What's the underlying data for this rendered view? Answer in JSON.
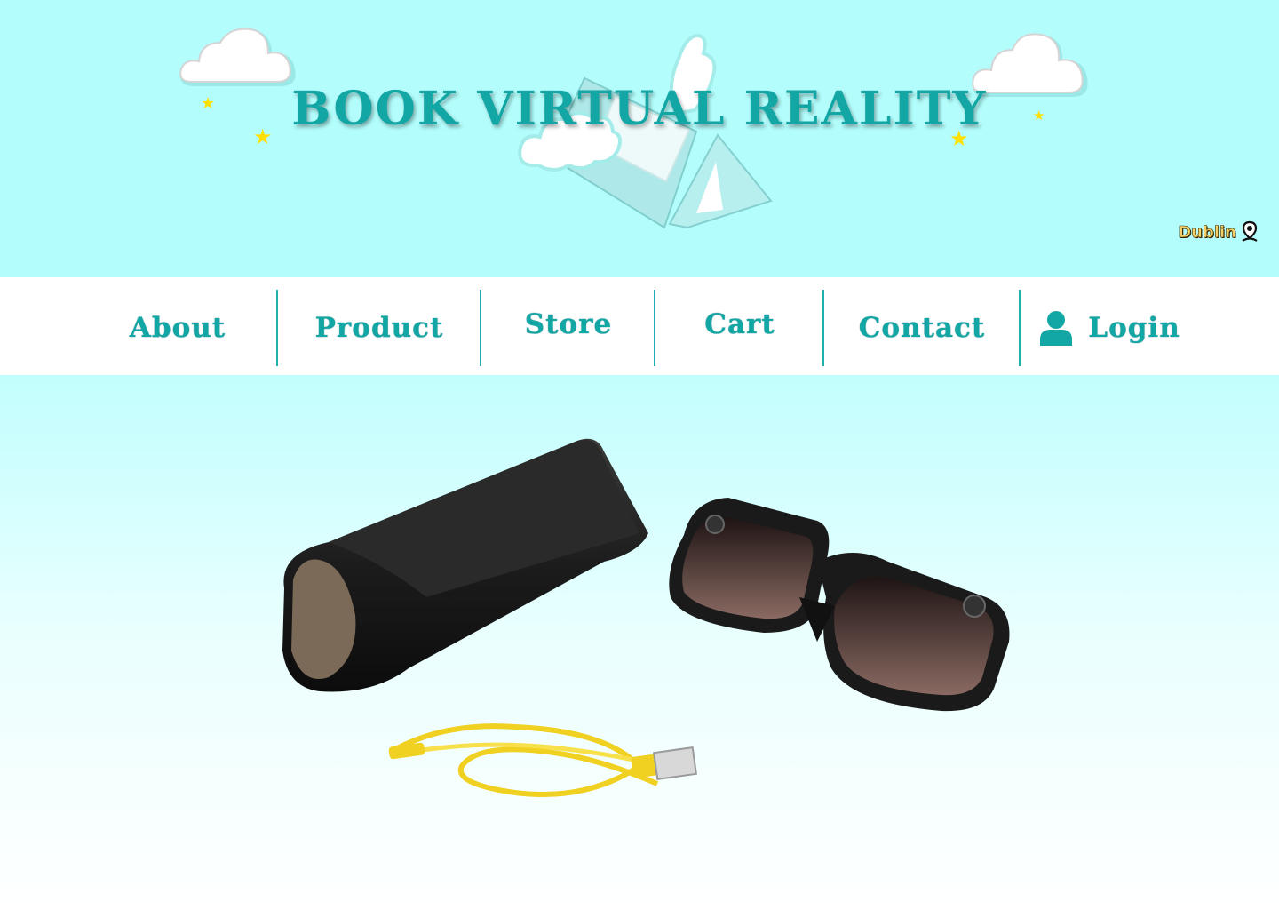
{
  "header": {
    "title": "BOOK VIRTUAL REALITY",
    "location": "Dublin"
  },
  "nav": {
    "items": [
      {
        "label": "About"
      },
      {
        "label": "Product"
      },
      {
        "label": "Store"
      },
      {
        "label": "Cart"
      },
      {
        "label": "Contact"
      },
      {
        "label": "Login"
      }
    ]
  },
  "icons": {
    "location": "location-pin-icon",
    "user": "user-icon",
    "cloud": "cloud-icon",
    "star": "star-icon"
  },
  "colors": {
    "header_bg": "#b3fefd",
    "accent": "#12a7a5",
    "star": "#ffe000",
    "nav_bg": "#ffffff",
    "location_text": "#f4d268"
  }
}
